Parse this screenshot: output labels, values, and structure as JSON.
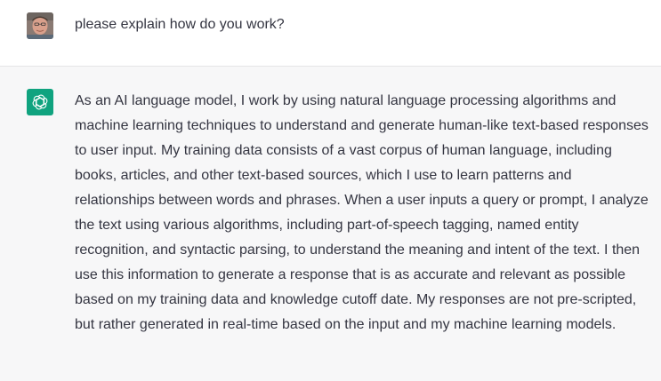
{
  "user_message": {
    "text": "please explain how do you work?",
    "avatar_icon": "user-photo-avatar"
  },
  "assistant_message": {
    "icon": "openai-logo-icon",
    "icon_color": "#10a37f",
    "text": "As an AI language model, I work by using natural language processing algorithms and machine learning techniques to understand and generate human-like text-based responses to user input. My training data consists of a vast corpus of human language, including books, articles, and other text-based sources, which I use to learn patterns and relationships between words and phrases. When a user inputs a query or prompt, I analyze the text using various algorithms, including part-of-speech tagging, named entity recognition, and syntactic parsing, to understand the meaning and intent of the text. I then use this information to generate a response that is as accurate and relevant as possible based on my training data and knowledge cutoff date. My responses are not pre-scripted, but rather generated in real-time based on the input and my machine learning models."
  }
}
